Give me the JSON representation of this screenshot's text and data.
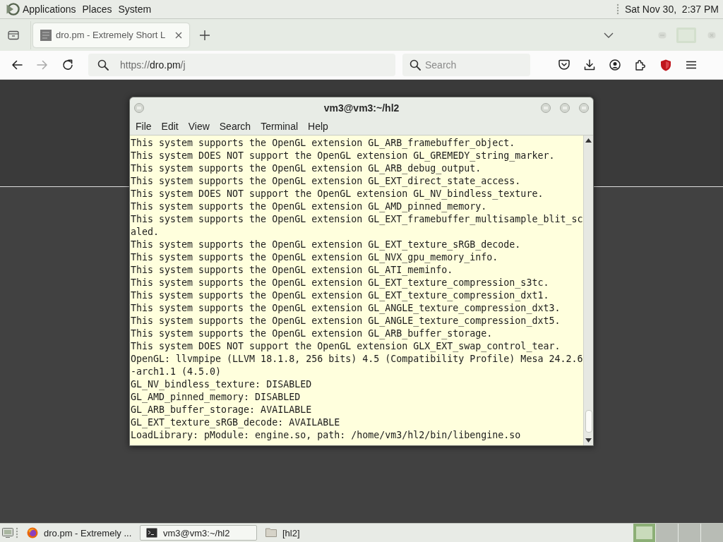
{
  "top_panel": {
    "menus": [
      "Applications",
      "Places",
      "System"
    ],
    "clock": "Sat Nov 30,  2:37 PM"
  },
  "browser": {
    "tabs": [
      {
        "title": "dro.pm - Extremely Short L",
        "selected": true
      }
    ],
    "back_button": {
      "disabled": false
    },
    "forward_button": {
      "disabled": true
    },
    "address": {
      "scheme": "https://",
      "host": "dro.pm",
      "path": "/j"
    },
    "search": {
      "placeholder": "Search"
    }
  },
  "terminal": {
    "title": "vm3@vm3:~/hl2",
    "menu": [
      "File",
      "Edit",
      "View",
      "Search",
      "Terminal",
      "Help"
    ],
    "lines": [
      "This system supports the OpenGL extension GL_ARB_framebuffer_object.",
      "This system DOES NOT support the OpenGL extension GL_GREMEDY_string_marker.",
      "This system supports the OpenGL extension GL_ARB_debug_output.",
      "This system supports the OpenGL extension GL_EXT_direct_state_access.",
      "This system DOES NOT support the OpenGL extension GL_NV_bindless_texture.",
      "This system supports the OpenGL extension GL_AMD_pinned_memory.",
      "This system supports the OpenGL extension GL_EXT_framebuffer_multisample_blit_scaled.",
      "This system supports the OpenGL extension GL_EXT_texture_sRGB_decode.",
      "This system supports the OpenGL extension GL_NVX_gpu_memory_info.",
      "This system supports the OpenGL extension GL_ATI_meminfo.",
      "This system supports the OpenGL extension GL_EXT_texture_compression_s3tc.",
      "This system supports the OpenGL extension GL_EXT_texture_compression_dxt1.",
      "This system supports the OpenGL extension GL_ANGLE_texture_compression_dxt3.",
      "This system supports the OpenGL extension GL_ANGLE_texture_compression_dxt5.",
      "This system supports the OpenGL extension GL_ARB_buffer_storage.",
      "This system DOES NOT support the OpenGL extension GLX_EXT_swap_control_tear.",
      "OpenGL: llvmpipe (LLVM 18.1.8, 256 bits) 4.5 (Compatibility Profile) Mesa 24.2.6-arch1.1 (4.5.0)",
      "GL_NV_bindless_texture: DISABLED",
      "GL_AMD_pinned_memory: DISABLED",
      "GL_ARB_buffer_storage: AVAILABLE",
      "GL_EXT_texture_sRGB_decode: AVAILABLE",
      "LoadLibrary: pModule: engine.so, path: /home/vm3/hl2/bin/libengine.so"
    ]
  },
  "taskbar": {
    "items": [
      {
        "kind": "browser",
        "label": "dro.pm - Extremely ...",
        "selected": false
      },
      {
        "kind": "terminal",
        "label": "vm3@vm3:~/hl2",
        "selected": true
      },
      {
        "kind": "folder",
        "label": "[hl2]",
        "selected": false
      }
    ],
    "workspaces": [
      {
        "selected": true
      },
      {
        "selected": false
      },
      {
        "selected": false
      },
      {
        "selected": false
      }
    ]
  }
}
